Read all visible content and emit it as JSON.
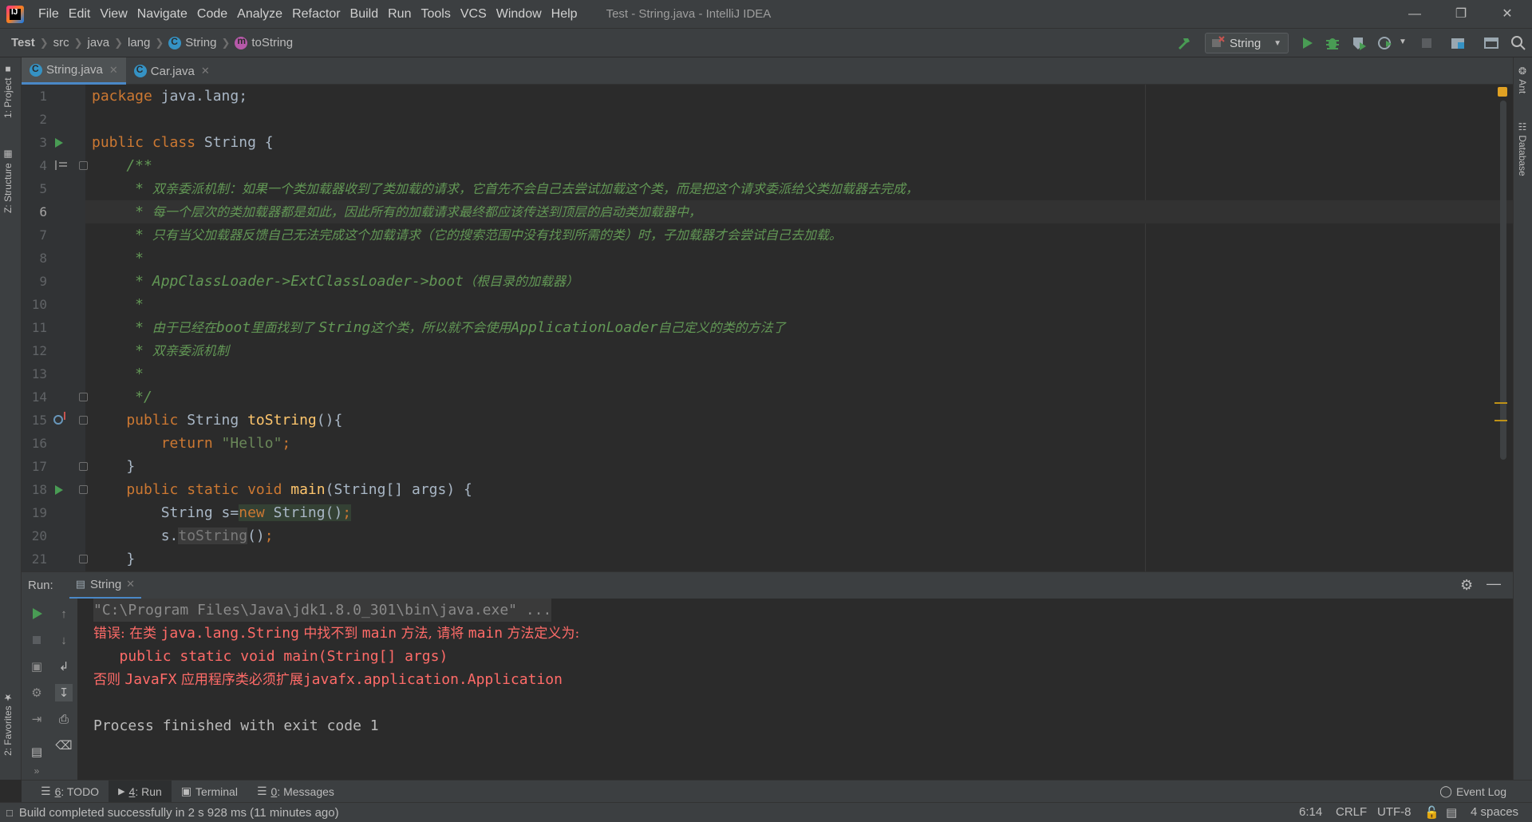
{
  "app": {
    "logo_text": "IJ",
    "window_title": "Test - String.java - IntelliJ IDEA"
  },
  "menu": [
    "File",
    "Edit",
    "View",
    "Navigate",
    "Code",
    "Analyze",
    "Refactor",
    "Build",
    "Run",
    "Tools",
    "VCS",
    "Window",
    "Help"
  ],
  "breadcrumb": {
    "project": "Test",
    "parts": [
      "src",
      "java",
      "lang"
    ],
    "class": "String",
    "method": "toString"
  },
  "toolbar": {
    "run_config": "String"
  },
  "left_stripe": {
    "project": "1: Project",
    "structure": "Z: Structure",
    "favorites": "2: Favorites"
  },
  "right_stripe": {
    "ant": "Ant",
    "database": "Database"
  },
  "tabs": [
    {
      "label": "String.java",
      "active": true
    },
    {
      "label": "Car.java",
      "active": false
    }
  ],
  "editor": {
    "current_line": 6,
    "line_numbers": [
      "1",
      "2",
      "3",
      "4",
      "5",
      "6",
      "7",
      "8",
      "9",
      "10",
      "11",
      "12",
      "13",
      "14",
      "15",
      "16",
      "17",
      "18",
      "19",
      "20",
      "21"
    ],
    "lines": {
      "l1_kw": "package",
      "l1_rest": " java.lang;",
      "l3_kw": "public class",
      "l3_rest": " String {",
      "l4": "    /**",
      "l5_star": "     * ",
      "l5_text": "双亲委派机制：如果一个类加载器收到了类加载的请求，它首先不会自己去尝试加载这个类，而是把这个请求委派给父类加载器去完成，",
      "l6_star": "     * ",
      "l6_text": "每一个层次的类加载器都是如此，因此所有的加载请求最终都应该传送到顶层的启动类加载器中，",
      "l7_star": "     * ",
      "l7_text": "只有当父加载器反馈自己无法完成这个加载请求（它的搜索范围中没有找到所需的类）时，子加载器才会尝试自己去加载。",
      "l8": "     *",
      "l9_code": "     * AppClassLoader->ExtClassLoader->boot",
      "l9_text": "（根目录的加载器）",
      "l10": "     *",
      "l11_star": "     * ",
      "l11_a": "由于已经在",
      "l11_b": "boot",
      "l11_c": "里面找到了 ",
      "l11_d": "String",
      "l11_e": "这个类，所以就不会使用",
      "l11_f": "ApplicationLoader",
      "l11_g": "自己定义的类的方法了",
      "l12_star": "     * ",
      "l12_text": "双亲委派机制",
      "l13": "     *",
      "l14": "     */",
      "l15_kw": "    public",
      "l15_type": " String ",
      "l15_fn": "toString",
      "l15_rest": "(){",
      "l16_kw": "        return",
      "l16_str": " \"Hello\"",
      "l16_end": ";",
      "l17": "    }",
      "l18_kw": "    public static void",
      "l18_fn": " main",
      "l18_rest": "(String[] args) {",
      "l19_a": "        String s=",
      "l19_kw": "new",
      "l19_b": " String()",
      "l19_end": ";",
      "l20_a": "        s.",
      "l20_fn": "toString",
      "l20_b": "()",
      "l20_end": ";",
      "l21": "    }"
    }
  },
  "run_panel": {
    "label": "Run:",
    "tab": "String",
    "console": {
      "cmd": "\"C:\\Program Files\\Java\\jdk1.8.0_301\\bin\\java.exe\" ...",
      "err1_a": "错误: 在类 ",
      "err1_b": "java.lang.String",
      "err1_c": " 中找不到 ",
      "err1_d": "main",
      "err1_e": " 方法, 请将 ",
      "err1_f": "main",
      "err1_g": " 方法定义为:",
      "err2": "   public static void main(String[] args)",
      "err3_a": "否则 ",
      "err3_b": "JavaFX",
      "err3_c": " 应用程序类必须扩展",
      "err3_d": "javafx.application.Application",
      "exit": "Process finished with exit code 1"
    }
  },
  "tool_tabs": {
    "todo_num": "6",
    "todo": ": TODO",
    "run_num": "4",
    "run": ": Run",
    "terminal": "Terminal",
    "messages_num": "0",
    "messages": ": Messages",
    "event_log": "Event Log"
  },
  "status": {
    "message": "Build completed successfully in 2 s 928 ms (11 minutes ago)",
    "position": "6:14",
    "line_sep": "CRLF",
    "encoding": "UTF-8",
    "indent": "4 spaces"
  },
  "colors": {
    "keyword": "#cc7832",
    "comment": "#629755",
    "string": "#6a8759",
    "method": "#ffc66d",
    "error": "#ff6b68",
    "run_green": "#499c54"
  }
}
